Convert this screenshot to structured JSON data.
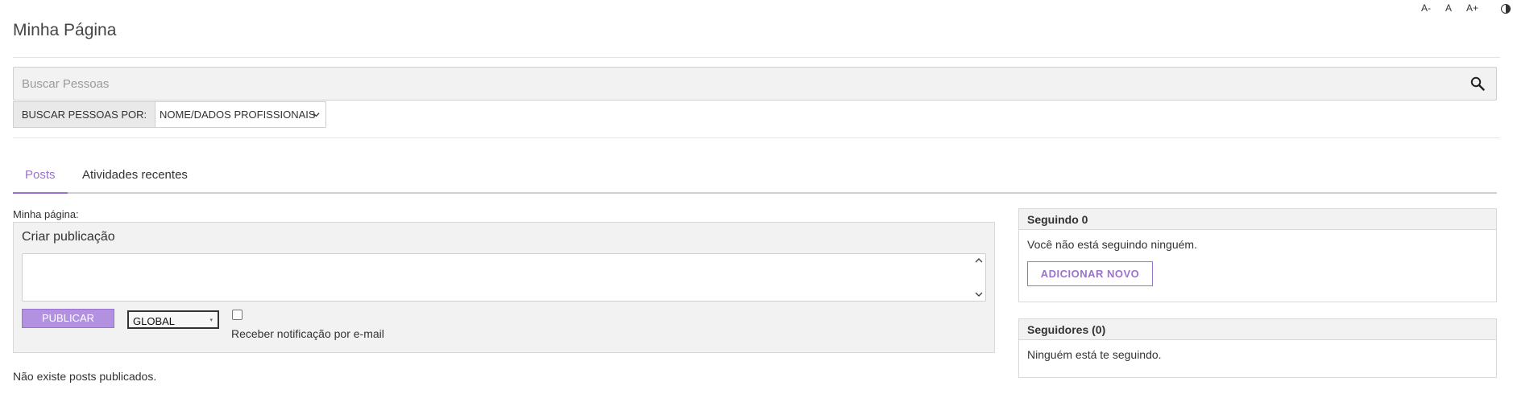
{
  "font_controls": {
    "decrease": "A-",
    "normal": "A",
    "increase": "A+"
  },
  "page": {
    "title": "Minha Página"
  },
  "search": {
    "placeholder": "Buscar Pessoas",
    "icon": "search-icon"
  },
  "search_by": {
    "label": "BUSCAR PESSOAS POR:",
    "selected": "NOME/DADOS PROFISSIONAIS"
  },
  "tabs": [
    {
      "label": "Posts",
      "active": true
    },
    {
      "label": "Atividades recentes",
      "active": false
    }
  ],
  "my_page": {
    "label": "Minha página:",
    "create_title": "Criar publicação",
    "publish_label": "PUBLICAR",
    "scope_selected": "GLOBAL",
    "notify_label": "Receber notificação por e-mail",
    "empty_text": "Não existe posts publicados."
  },
  "following": {
    "title": "Seguindo 0",
    "body": "Você não está seguindo ninguém.",
    "add_label": "ADICIONAR NOVO"
  },
  "followers": {
    "title": "Seguidores (0)",
    "body": "Ninguém está te seguindo."
  },
  "colors": {
    "accent": "#9b72cf",
    "publish_bg": "#b292e0",
    "panel_bg": "#f2f2f2"
  }
}
